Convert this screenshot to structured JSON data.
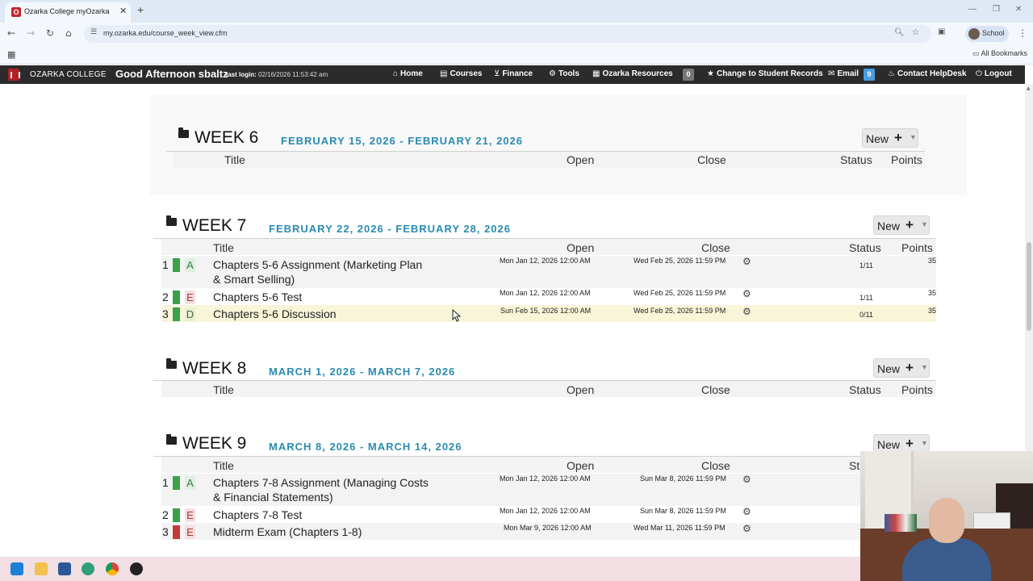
{
  "browser": {
    "tab_title": "Ozarka College myOzarka",
    "url": "my.ozarka.edu/course_week_view.cfm",
    "profile_label": "School",
    "all_bookmarks": "All Bookmarks"
  },
  "nav": {
    "brand": "OZARKA COLLEGE",
    "greeting": "Good Afternoon sbaltz",
    "last_login_label": "last login:",
    "last_login_value": "02/16/2026 11:53:42 am",
    "items": {
      "home": "Home",
      "courses": "Courses",
      "finance": "Finance",
      "tools": "Tools",
      "resources": "Ozarka Resources",
      "resources_count": "0",
      "change_records": "Change to Student Records",
      "email": "Email",
      "email_count": "9",
      "helpdesk": "Contact HelpDesk",
      "logout": "Logout"
    }
  },
  "columns": {
    "title": "Title",
    "open": "Open",
    "close": "Close",
    "status": "Status",
    "points": "Points",
    "status_partial": "St"
  },
  "new_label": "New",
  "weeks": {
    "w6": {
      "title": "WEEK 6",
      "dates": "FEBRUARY 15, 2026 - FEBRUARY 21, 2026"
    },
    "w7": {
      "title": "WEEK 7",
      "dates": "FEBRUARY 22, 2026 - FEBRUARY 28, 2026",
      "items": [
        {
          "num": "1",
          "type": "A",
          "title_line1": "Chapters 5-6 Assignment (Marketing Plan",
          "title_line2": "& Smart Selling)",
          "open": "Mon Jan 12, 2026 12:00 AM",
          "close": "Wed Feb 25, 2026 11:59 PM",
          "status": "1/11",
          "points": "35"
        },
        {
          "num": "2",
          "type": "E",
          "title_line1": "Chapters 5-6 Test",
          "open": "Mon Jan 12, 2026 12:00 AM",
          "close": "Wed Feb 25, 2026 11:59 PM",
          "status": "1/11",
          "points": "35"
        },
        {
          "num": "3",
          "type": "D",
          "title_line1": "Chapters 5-6 Discussion",
          "open": "Sun Feb 15, 2026 12:00 AM",
          "close": "Wed Feb 25, 2026 11:59 PM",
          "status": "0/11",
          "points": "35"
        }
      ]
    },
    "w8": {
      "title": "WEEK 8",
      "dates": "MARCH 1, 2026 - MARCH 7, 2026"
    },
    "w9": {
      "title": "WEEK 9",
      "dates": "MARCH 8, 2026 - MARCH 14, 2026",
      "items": [
        {
          "num": "1",
          "type": "A",
          "title_line1": "Chapters 7-8 Assignment (Managing Costs",
          "title_line2": "& Financial Statements)",
          "open": "Mon Jan 12, 2026 12:00 AM",
          "close": "Sun Mar 8, 2026 11:59 PM"
        },
        {
          "num": "2",
          "type": "E",
          "title_line1": "Chapters 7-8 Test",
          "open": "Mon Jan 12, 2026 12:00 AM",
          "close": "Sun Mar 8, 2026 11:59 PM"
        },
        {
          "num": "3",
          "type": "E",
          "title_line1": "Midterm Exam (Chapters 1-8)",
          "open": "Mon Mar 9, 2026 12:00 AM",
          "close": "Wed Mar 11, 2026 11:59 PM"
        }
      ]
    }
  },
  "colors": {
    "accent_dates": "#2a8bb0",
    "published_green": "#3aa14a",
    "unpublished_red": "#c43a3a",
    "nav_bg": "#2b2b2b",
    "row_highlight": "#f8f5d8"
  }
}
